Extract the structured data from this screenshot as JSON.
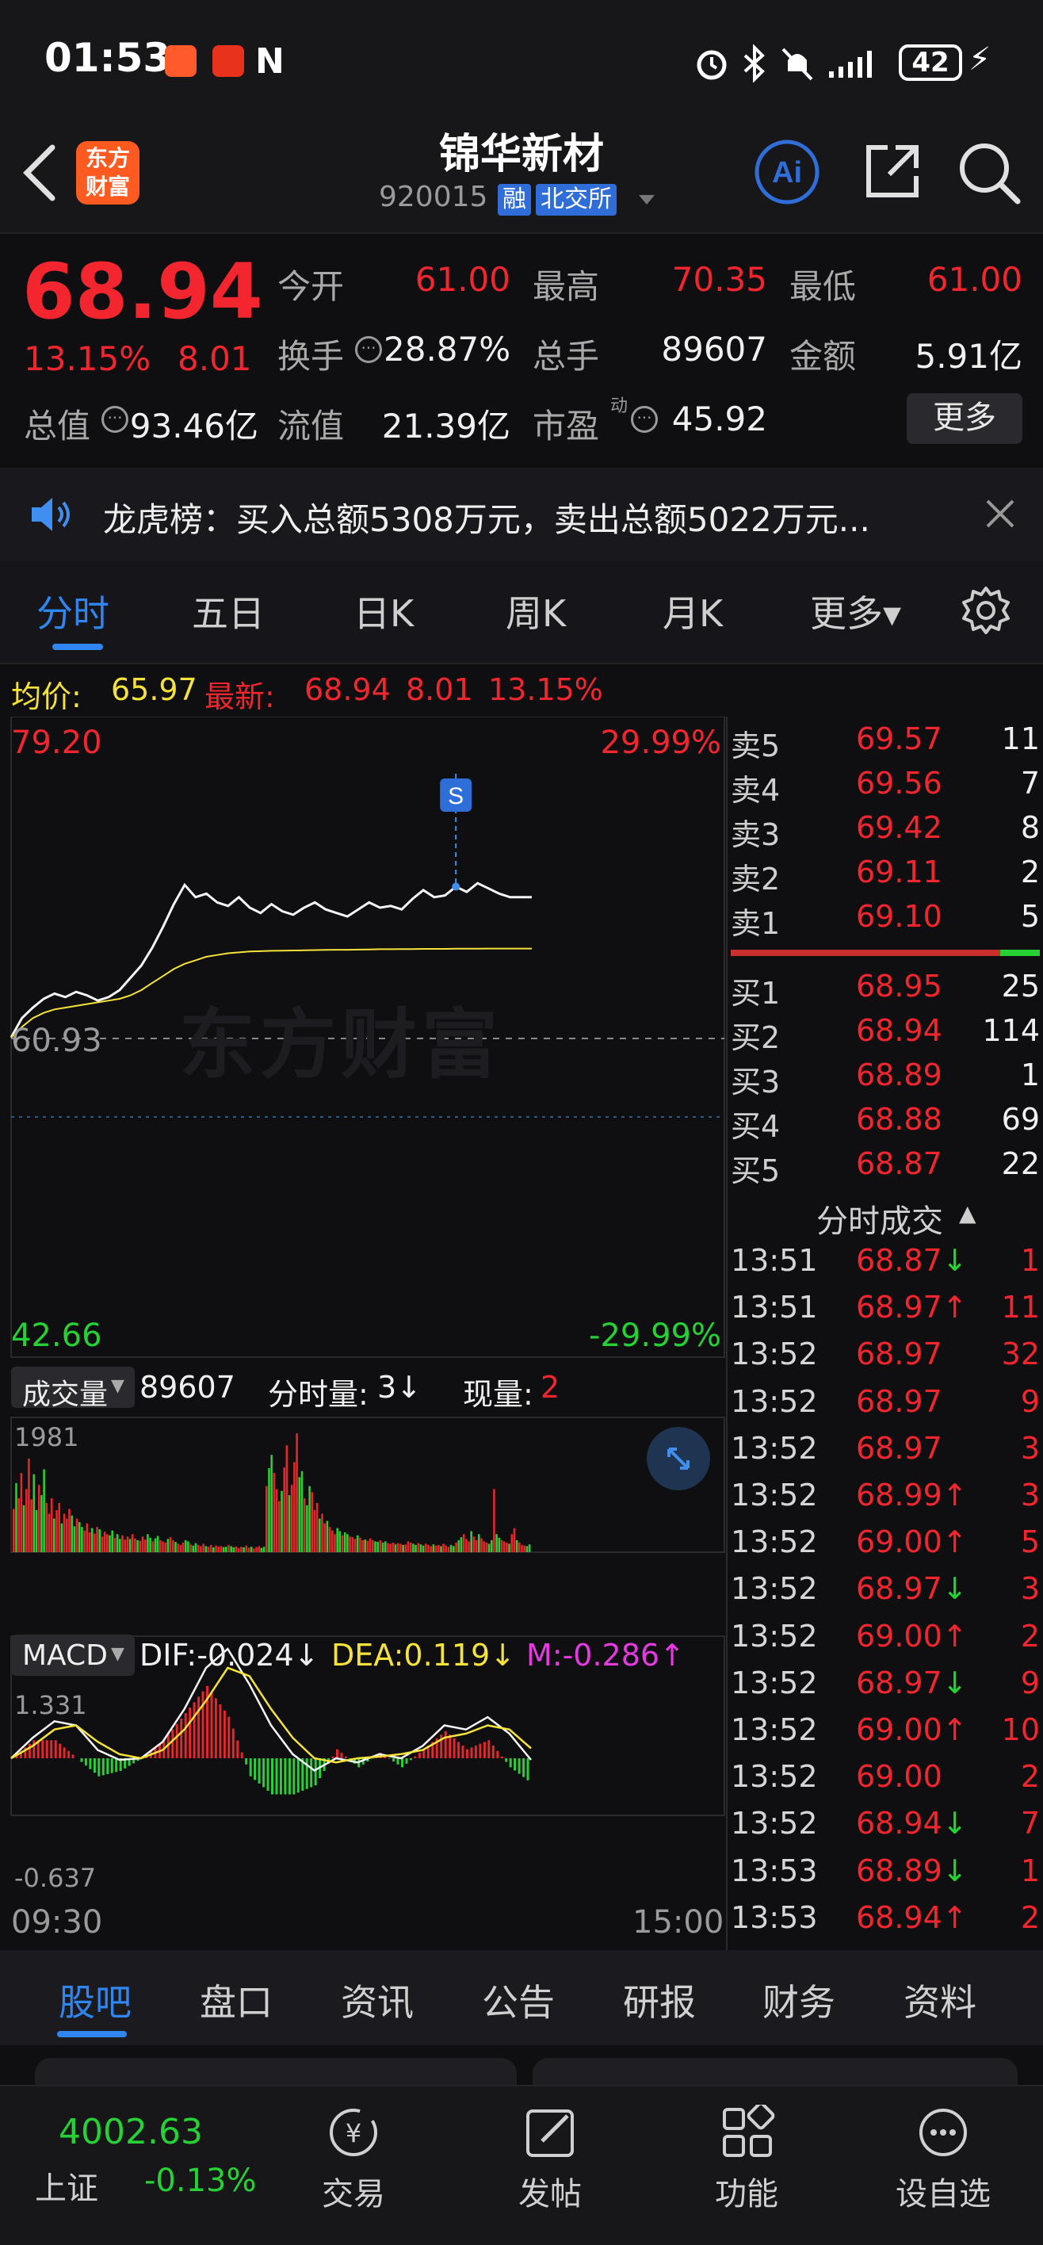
{
  "status_bar": {
    "time": "01:53",
    "battery": "42",
    "icons": [
      "alarm-icon",
      "bluetooth-icon",
      "mute-icon",
      "signal-icon",
      "battery-icon",
      "charging-icon"
    ]
  },
  "header": {
    "logo_text": "东方财富",
    "stock_name": "锦华新材",
    "stock_code": "920015",
    "tag_margin": "融",
    "tag_exchange": "北交所"
  },
  "quote": {
    "price": "68.94",
    "change_pct": "13.15%",
    "change": "8.01",
    "open_label": "今开",
    "open": "61.00",
    "high_label": "最高",
    "high": "70.35",
    "low_label": "最低",
    "low": "61.00",
    "turnover_label": "换手",
    "turnover": "28.87%",
    "volume_label": "总手",
    "volume": "89607",
    "amount_label": "金额",
    "amount": "5.91亿",
    "mktcap_label": "总值",
    "mktcap": "93.46亿",
    "float_label": "流值",
    "float": "21.39亿",
    "pe_label": "市盈",
    "pe_sup": "动",
    "pe": "45.92",
    "more_button": "更多"
  },
  "notice": {
    "text": "龙虎榜：买入总额5308万元，卖出总额5022万元..."
  },
  "chart_tabs": [
    "分时",
    "五日",
    "日K",
    "周K",
    "月K",
    "更多▾"
  ],
  "info_line": {
    "avg_label": "均价:",
    "avg": "65.97",
    "latest_label": "最新:",
    "latest": "68.94",
    "latest_change": "8.01",
    "latest_pct": "13.15%"
  },
  "chart_data": [
    {
      "type": "line",
      "title": "",
      "xlabel": "",
      "ylabel": "",
      "x_range_labels": [
        "09:30",
        "15:00"
      ],
      "ylim": [
        42.66,
        79.2
      ],
      "y_left_labels": [
        "79.20",
        "60.93",
        "42.66"
      ],
      "y_right_labels": [
        "29.99%",
        "-29.99%"
      ],
      "prev_close": 60.93,
      "watermark": "东方财富",
      "marker": "S",
      "x": [
        0,
        5,
        10,
        15,
        20,
        25,
        30,
        35,
        40,
        45,
        50,
        55,
        60,
        65,
        70,
        75,
        80,
        85,
        90,
        95,
        100,
        105,
        110,
        115,
        120,
        125,
        130,
        135,
        140,
        145,
        150,
        155,
        160,
        165,
        170,
        175,
        180,
        185,
        190,
        195,
        200,
        205,
        210,
        215,
        220,
        225,
        230,
        235,
        240
      ],
      "series": [
        {
          "name": "",
          "values": [
            60.9,
            62.0,
            62.6,
            63.1,
            63.4,
            63.2,
            63.5,
            63.3,
            63.0,
            63.2,
            63.6,
            64.3,
            65.0,
            66.0,
            67.2,
            68.5,
            69.6,
            68.9,
            69.1,
            68.6,
            68.4,
            68.9,
            68.3,
            68.0,
            68.5,
            68.1,
            67.9,
            68.3,
            68.6,
            68.2,
            68.0,
            67.8,
            68.2,
            68.6,
            68.3,
            68.4,
            68.2,
            68.8,
            69.3,
            68.9,
            69.0,
            69.5,
            69.2,
            69.7,
            69.4,
            69.1,
            68.9,
            68.9,
            68.9
          ]
        },
        {
          "name": "",
          "values": [
            60.9,
            61.5,
            62.0,
            62.3,
            62.5,
            62.6,
            62.7,
            62.8,
            62.9,
            63.0,
            63.1,
            63.3,
            63.6,
            64.0,
            64.4,
            64.8,
            65.1,
            65.3,
            65.5,
            65.6,
            65.7,
            65.75,
            65.8,
            65.82,
            65.84,
            65.85,
            65.86,
            65.87,
            65.88,
            65.89,
            65.9,
            65.9,
            65.91,
            65.92,
            65.93,
            65.93,
            65.94,
            65.94,
            65.95,
            65.95,
            65.95,
            65.96,
            65.96,
            65.96,
            65.97,
            65.97,
            65.97,
            65.97,
            65.97
          ]
        }
      ]
    },
    {
      "type": "bar",
      "title": "",
      "indicator_label": "成交量",
      "total_volume": "89607",
      "minute_volume_label": "分时量:",
      "minute_volume": "3",
      "current_volume_label": "现量:",
      "current_volume": "2",
      "y_max_label": "1981",
      "ylim": [
        0,
        1981
      ],
      "values": [
        720,
        1150,
        900,
        1320,
        780,
        1050,
        1560,
        880,
        1300,
        700,
        1120,
        950,
        1380,
        820,
        640,
        900,
        560,
        700,
        820,
        480,
        640,
        560,
        720,
        610,
        430,
        560,
        500,
        420,
        360,
        480,
        330,
        400,
        310,
        420,
        380,
        260,
        340,
        300,
        280,
        360,
        240,
        300,
        220,
        280,
        210,
        260,
        220,
        300,
        230,
        200,
        190,
        260,
        210,
        300,
        240,
        180,
        230,
        270,
        200,
        180,
        160,
        220,
        250,
        200,
        170,
        140,
        120,
        160,
        200,
        180,
        130,
        110,
        150,
        120,
        100,
        140,
        100,
        90,
        120,
        80,
        110,
        95,
        100,
        85,
        90,
        120,
        100,
        80,
        95,
        70,
        90,
        80,
        110,
        75,
        90,
        60,
        85,
        100,
        70,
        90,
        1100,
        1400,
        1620,
        1320,
        1050,
        850,
        1020,
        1410,
        1780,
        950,
        1120,
        1500,
        1980,
        1250,
        1350,
        900,
        780,
        1100,
        1000,
        700,
        820,
        560,
        640,
        480,
        520,
        420,
        360,
        300,
        400,
        350,
        280,
        330,
        300,
        260,
        250,
        220,
        280,
        240,
        200,
        210,
        190,
        230,
        200,
        180,
        170,
        200,
        160,
        180,
        150,
        140,
        160,
        130,
        150,
        140,
        120,
        130,
        180,
        160,
        140,
        120,
        150,
        130,
        110,
        140,
        120,
        100,
        130,
        110,
        120,
        100,
        140,
        110,
        90,
        120,
        100,
        160,
        200,
        250,
        300,
        220,
        180,
        350,
        260,
        200,
        300,
        230,
        180,
        160,
        140,
        200,
        1050,
        300,
        240,
        200,
        180,
        160,
        140,
        300,
        400,
        200,
        160,
        120,
        110,
        100,
        130
      ],
      "colors": [
        "red",
        "green"
      ]
    },
    {
      "type": "line",
      "title": "",
      "indicator_label": "MACD",
      "dif_label": "DIF:",
      "dif": "-0.024",
      "dea_label": "DEA:",
      "dea": "0.119",
      "m_label": "M:",
      "m": "-0.286",
      "y_max_label": "1.331",
      "y_min_label": "-0.637",
      "ylim": [
        -0.637,
        1.331
      ],
      "x": [
        0,
        10,
        20,
        30,
        40,
        50,
        60,
        70,
        80,
        90,
        100,
        110,
        120,
        130,
        140,
        150,
        160,
        170,
        180,
        190,
        200,
        210,
        220,
        230,
        240
      ],
      "series": [
        {
          "name": "DIF",
          "values": [
            0.0,
            0.25,
            0.45,
            0.4,
            0.1,
            -0.02,
            0.0,
            0.2,
            0.6,
            1.1,
            1.33,
            0.9,
            0.4,
            0.05,
            -0.15,
            0.0,
            -0.05,
            0.05,
            0.0,
            0.15,
            0.4,
            0.35,
            0.5,
            0.3,
            -0.02
          ]
        },
        {
          "name": "DEA",
          "values": [
            0.0,
            0.15,
            0.35,
            0.4,
            0.2,
            0.05,
            0.0,
            0.1,
            0.35,
            0.7,
            1.1,
            1.0,
            0.6,
            0.25,
            0.0,
            -0.05,
            0.0,
            0.02,
            0.05,
            0.1,
            0.25,
            0.3,
            0.4,
            0.35,
            0.12
          ]
        }
      ]
    }
  ],
  "order_book": {
    "asks": [
      {
        "label": "卖5",
        "price": "69.57",
        "vol": "11"
      },
      {
        "label": "卖4",
        "price": "69.56",
        "vol": "7"
      },
      {
        "label": "卖3",
        "price": "69.42",
        "vol": "8"
      },
      {
        "label": "卖2",
        "price": "69.11",
        "vol": "2"
      },
      {
        "label": "卖1",
        "price": "69.10",
        "vol": "5"
      }
    ],
    "bids": [
      {
        "label": "买1",
        "price": "68.95",
        "vol": "25"
      },
      {
        "label": "买2",
        "price": "68.94",
        "vol": "114"
      },
      {
        "label": "买3",
        "price": "68.89",
        "vol": "1"
      },
      {
        "label": "买4",
        "price": "68.88",
        "vol": "69"
      },
      {
        "label": "买5",
        "price": "68.87",
        "vol": "22"
      }
    ],
    "ticks_title": "分时成交",
    "ticks": [
      {
        "time": "13:51",
        "price": "68.87",
        "dir": "down",
        "vol": "1"
      },
      {
        "time": "13:51",
        "price": "68.97",
        "dir": "up",
        "vol": "11"
      },
      {
        "time": "13:52",
        "price": "68.97",
        "dir": "",
        "vol": "32"
      },
      {
        "time": "13:52",
        "price": "68.97",
        "dir": "",
        "vol": "9"
      },
      {
        "time": "13:52",
        "price": "68.97",
        "dir": "",
        "vol": "3"
      },
      {
        "time": "13:52",
        "price": "68.99",
        "dir": "up",
        "vol": "3"
      },
      {
        "time": "13:52",
        "price": "69.00",
        "dir": "up",
        "vol": "5"
      },
      {
        "time": "13:52",
        "price": "68.97",
        "dir": "down",
        "vol": "3"
      },
      {
        "time": "13:52",
        "price": "69.00",
        "dir": "up",
        "vol": "2"
      },
      {
        "time": "13:52",
        "price": "68.97",
        "dir": "down",
        "vol": "9"
      },
      {
        "time": "13:52",
        "price": "69.00",
        "dir": "up",
        "vol": "10"
      },
      {
        "time": "13:52",
        "price": "69.00",
        "dir": "",
        "vol": "2"
      },
      {
        "time": "13:52",
        "price": "68.94",
        "dir": "down",
        "vol": "7"
      },
      {
        "time": "13:53",
        "price": "68.89",
        "dir": "down",
        "vol": "1"
      },
      {
        "time": "13:53",
        "price": "68.94",
        "dir": "up",
        "vol": "2"
      }
    ]
  },
  "bottom_tabs": [
    "股吧",
    "盘口",
    "资讯",
    "公告",
    "研报",
    "财务",
    "资料"
  ],
  "nav": {
    "index_value": "4002.63",
    "index_name": "上证",
    "index_change": "-0.13%",
    "items": [
      "交易",
      "发帖",
      "功能",
      "设自选"
    ]
  },
  "colors": {
    "up": "#f3262f",
    "down": "#25d135",
    "avg_line": "#f5e33a",
    "accent_blue": "#2f6ed8",
    "background": "#0f0f11"
  }
}
